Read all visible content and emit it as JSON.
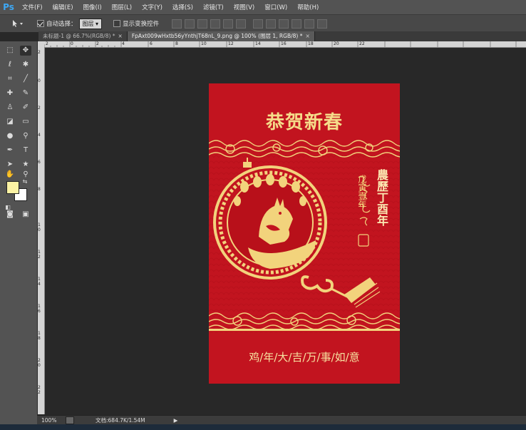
{
  "app": {
    "logo": "Ps"
  },
  "menubar": {
    "items": [
      "文件(F)",
      "编辑(E)",
      "图像(I)",
      "图层(L)",
      "文字(Y)",
      "选择(S)",
      "滤镜(T)",
      "视图(V)",
      "窗口(W)",
      "帮助(H)"
    ]
  },
  "options": {
    "auto_select_label": "自动选择：",
    "auto_select_value": "图层",
    "show_transform_label": "显示变换控件"
  },
  "tabs": [
    {
      "label": "未标题-1 @ 66.7%(RGB/8) *",
      "close": "×"
    },
    {
      "label": "FpAxt009wHxtb56yYnthjT68nL_9.png @ 100% (图层 1, RGB/8) *",
      "close": "×"
    }
  ],
  "ruler": {
    "top_labels": [
      "2",
      "0",
      "2",
      "4",
      "6",
      "8",
      "10",
      "12",
      "14",
      "16",
      "18",
      "20",
      "22"
    ],
    "left_labels": [
      "2",
      "0",
      "2",
      "4",
      "6",
      "8",
      "1 0",
      "1 2",
      "1 4",
      "1 6",
      "1 8",
      "2 0",
      "2 2"
    ]
  },
  "card": {
    "title": "恭贺新春",
    "side_red_text": "農歷丁酉年",
    "side_calligraphy": "戊寅壹年",
    "bottom_text": "鸡/年/大/吉/万/事/如/意"
  },
  "status": {
    "zoom": "100%",
    "doc_info": "文档:684.7K/1.54M"
  },
  "colors": {
    "foreground": "#fcf3a4",
    "background": "#ffffff",
    "card_red": "#c2141f",
    "gold": "#f5dc8a"
  }
}
